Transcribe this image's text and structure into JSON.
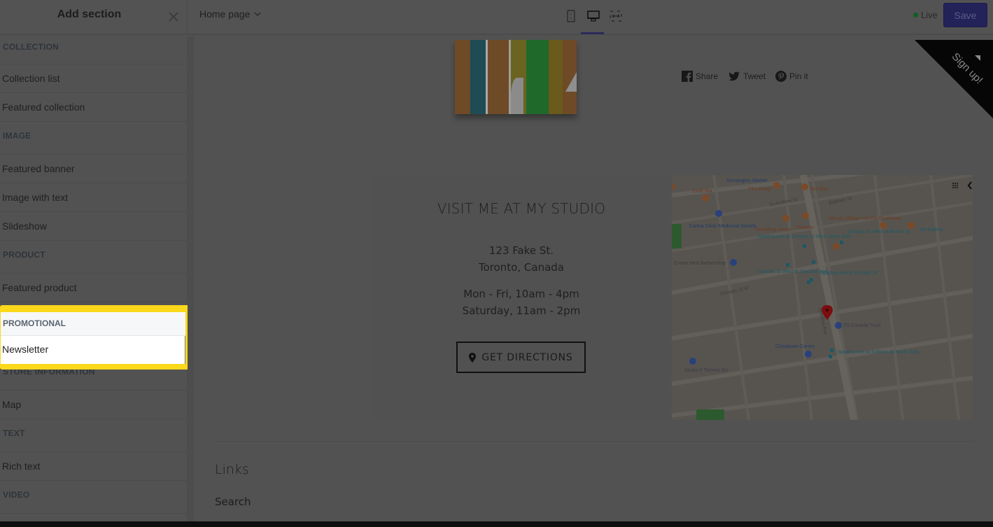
{
  "topbar": {
    "sidebar_title": "Add section",
    "page_selector": "Home page",
    "devices": [
      "mobile",
      "desktop",
      "full-width"
    ],
    "active_device": "desktop",
    "live_label": "Live",
    "save_label": "Save"
  },
  "colors": {
    "highlight": "#fcd81b",
    "save_button": "#23235a",
    "live_dot": "#0f5e22",
    "active_tab_underline": "#2b2b5a"
  },
  "sidebar": {
    "groups": [
      {
        "header": "COLLECTION",
        "items": [
          "Collection list",
          "Featured collection"
        ]
      },
      {
        "header": "IMAGE",
        "items": [
          "Featured banner",
          "Image with text",
          "Slideshow"
        ]
      },
      {
        "header": "PRODUCT",
        "items": [
          "Featured product"
        ]
      },
      {
        "header": "PROMOTIONAL",
        "items": [
          "Newsletter"
        ],
        "highlighted": true
      },
      {
        "header": "STORE INFORMATION",
        "items": [
          "Map"
        ]
      },
      {
        "header": "TEXT",
        "items": [
          "Rich text"
        ]
      },
      {
        "header": "VIDEO",
        "items": []
      }
    ]
  },
  "preview": {
    "share": [
      {
        "icon": "facebook-icon",
        "label": "Share"
      },
      {
        "icon": "twitter-icon",
        "label": "Tweet"
      },
      {
        "icon": "pinterest-icon",
        "label": "Pin it"
      }
    ],
    "signup_ribbon": "Sign up!",
    "studio": {
      "title": "VISIT ME AT MY STUDIO",
      "address_line1": "123 Fake St.",
      "address_line2": "Toronto, Canada",
      "hours_line1": "Mon - Fri, 10am - 4pm",
      "hours_line2": "Saturday, 11am - 2pm",
      "directions_label": "GET DIRECTIONS"
    },
    "map_labels": [
      "Kensington Market",
      "Pho Hung",
      "Rol San",
      "Cold Tea",
      "Canna Clinic Medicinal Society",
      "Dumpling House",
      "Swatow",
      "Spadina Ave at Dundas St West North Side",
      "Morals Village Hot Pot Downtown",
      "Dundas St West at Huron St",
      "Art Gallery",
      "Crows Nest Barbershop",
      "Dundas St West at Spadina Ave",
      "Spadina Ave at Dundas St",
      "TD Canada Trust",
      "Chinatown Centre",
      "Spadina Ave at Sullivan St North Side",
      "Studio 6 Toronto On",
      "Dundas St W",
      "Spadina Ave",
      "St Andrew St",
      "Baldwin St"
    ],
    "footer": {
      "links_title": "Links",
      "links": [
        "Search"
      ]
    }
  }
}
